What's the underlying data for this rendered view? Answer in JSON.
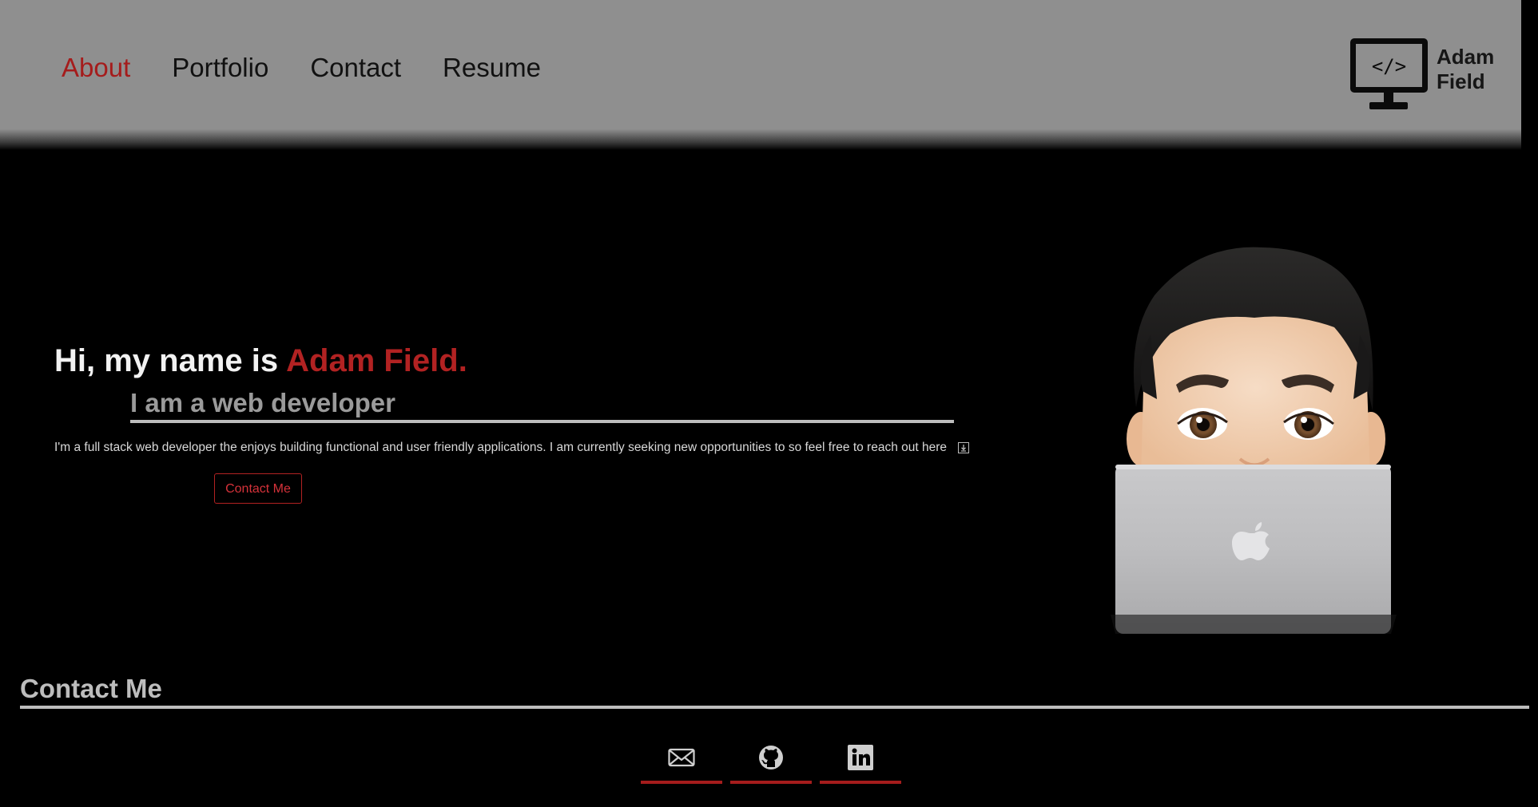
{
  "nav": {
    "items": [
      {
        "label": "About",
        "active": true
      },
      {
        "label": "Portfolio",
        "active": false
      },
      {
        "label": "Contact",
        "active": false
      },
      {
        "label": "Resume",
        "active": false
      }
    ]
  },
  "logo": {
    "code_glyph": "</>",
    "text": "Adam\nField"
  },
  "hero": {
    "greeting": "Hi, my name is",
    "name": "Adam Field.",
    "subtitle": "I am a web developer",
    "description": "I'm a full stack web developer the enjoys building functional and user friendly applications. I am currently seeking new opportunities to so feel free to reach out here",
    "contact_button": "Contact Me"
  },
  "contact": {
    "heading": "Contact Me",
    "links": [
      {
        "icon": "email-icon"
      },
      {
        "icon": "github-icon"
      },
      {
        "icon": "linkedin-icon"
      }
    ]
  },
  "colors": {
    "accent": "#b22222",
    "header_bg": "#8f8f8f",
    "page_bg": "#000000",
    "muted_text": "#bdbdbd"
  }
}
